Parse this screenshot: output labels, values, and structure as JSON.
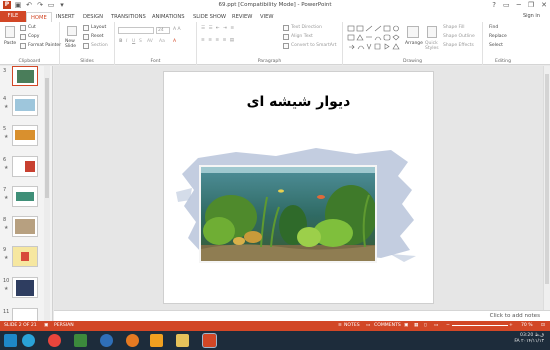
{
  "window": {
    "title": "69.ppt [Compatibility Mode] - PowerPoint",
    "help_label": "?",
    "minimize_label": "─",
    "restore_label": "❐",
    "close_label": "✕",
    "signin_label": "Sign in"
  },
  "tabs": [
    {
      "label": "FILE"
    },
    {
      "label": "HOME"
    },
    {
      "label": "INSERT"
    },
    {
      "label": "DESIGN"
    },
    {
      "label": "TRANSITIONS"
    },
    {
      "label": "ANIMATIONS"
    },
    {
      "label": "SLIDE SHOW"
    },
    {
      "label": "REVIEW"
    },
    {
      "label": "VIEW"
    }
  ],
  "ribbon": {
    "clipboard": {
      "paste": "Paste",
      "cut": "Cut",
      "copy": "Copy",
      "format_painter": "Format Painter",
      "label": "Clipboard"
    },
    "slides": {
      "new_slide": "New Slide",
      "layout": "Layout",
      "reset": "Reset",
      "section": "Section",
      "label": "Slides"
    },
    "font": {
      "font_size": "24",
      "label": "Font"
    },
    "paragraph": {
      "text_direction": "Text Direction",
      "align_text": "Align Text",
      "convert_smartart": "Convert to SmartArt",
      "label": "Paragraph"
    },
    "drawing": {
      "arrange": "Arrange",
      "quick_styles": "Quick Styles",
      "shape_fill": "Shape Fill",
      "shape_outline": "Shape Outline",
      "shape_effects": "Shape Effects",
      "label": "Drawing"
    },
    "editing": {
      "find": "Find",
      "replace": "Replace",
      "select": "Select",
      "label": "Editing"
    }
  },
  "thumbnails": [
    {
      "num": "3"
    },
    {
      "num": "4"
    },
    {
      "num": "5"
    },
    {
      "num": "6"
    },
    {
      "num": "7"
    },
    {
      "num": "8"
    },
    {
      "num": "9"
    },
    {
      "num": "10"
    },
    {
      "num": "11"
    }
  ],
  "slide": {
    "title": "دیوار شیشه ای"
  },
  "notes": {
    "placeholder": "Click to add notes"
  },
  "status": {
    "slide_info": "SLIDE 2 OF 21",
    "language": "PERSIAN",
    "notes": "NOTES",
    "comments": "COMMENTS",
    "zoom": "70 %"
  },
  "taskbar": {
    "time": "03:20 ق.ظ",
    "date": "۲۰۱۴/۱۱/۱۳",
    "lang": "FA"
  },
  "colors": {
    "accent": "#d24726",
    "taskbar": "#1d2c3b"
  }
}
